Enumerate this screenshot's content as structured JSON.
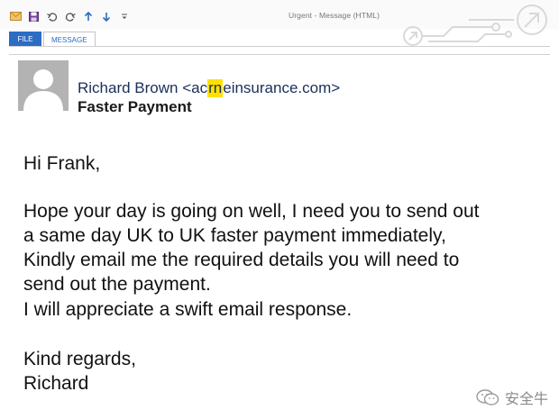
{
  "window": {
    "title": "Urgent - Message (HTML)"
  },
  "quick_access": [
    {
      "name": "mail-icon"
    },
    {
      "name": "save-icon"
    },
    {
      "name": "undo-icon"
    },
    {
      "name": "redo-icon"
    },
    {
      "name": "arrow-up-icon"
    },
    {
      "name": "arrow-down-icon"
    },
    {
      "name": "customize-icon"
    }
  ],
  "ribbon": {
    "tabs": [
      {
        "label": "FILE",
        "active": false
      },
      {
        "label": "MESSAGE",
        "active": true
      }
    ]
  },
  "header": {
    "sender_name": "Richard Brown",
    "sender_email_prefix": "<ac",
    "sender_email_highlight": "rn",
    "sender_email_suffix": "einsurance.com>",
    "subject": "Faster Payment"
  },
  "body": {
    "greeting": "Hi Frank,",
    "paragraph_lines": [
      "Hope your day is going on well, I need you to send out",
      "a same day UK to UK faster payment immediately,",
      "Kindly email me the required details you will need to",
      "send out the payment.",
      "I will appreciate a swift email response."
    ],
    "closing": "Kind regards,",
    "signature": "Richard"
  },
  "watermark": {
    "text": "安全牛"
  },
  "colors": {
    "file_tab": "#2b6cc4",
    "highlight": "#ffe100",
    "sender_text": "#1a2f5a"
  }
}
